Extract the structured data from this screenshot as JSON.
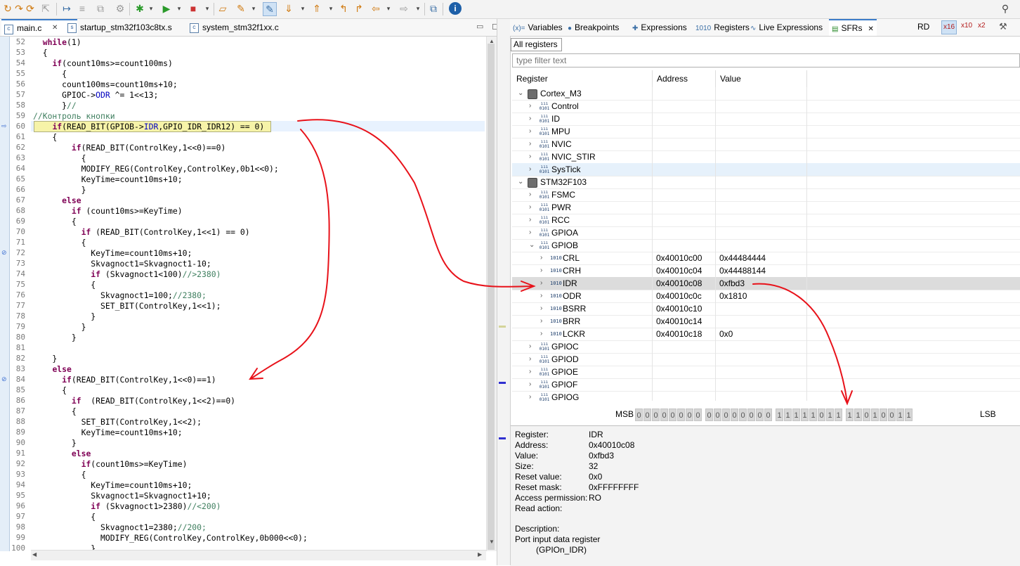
{
  "toolbar": {
    "icons": [
      "debug-icon",
      "restart-icon",
      "skip-icon",
      "terminate-icon",
      "step-into-icon",
      "step-over-icon",
      "step-return-icon",
      "run-icon",
      "debug-dropdown-icon",
      "run-dropdown-icon",
      "stop-icon",
      "open-folder-icon",
      "pin-icon",
      "highlight-icon",
      "next-annotation-icon",
      "prev-annotation-icon",
      "back-icon",
      "forward-icon",
      "open-perspective-icon",
      "info-icon",
      "search-icon"
    ]
  },
  "editor": {
    "tabs": [
      {
        "label": "main.c",
        "icon": "c",
        "close": "✕"
      },
      {
        "label": "startup_stm32f103c8tx.s",
        "icon": "s"
      },
      {
        "label": "system_stm32f1xx.c",
        "icon": "c"
      }
    ],
    "lines": [
      {
        "n": "52",
        "t": "  while(1)"
      },
      {
        "n": "53",
        "t": "  {"
      },
      {
        "n": "54",
        "t": "    if(count10ms>=count100ms)"
      },
      {
        "n": "55",
        "t": "      {"
      },
      {
        "n": "56",
        "t": "      count100ms=count10ms+10;"
      },
      {
        "n": "57",
        "t": "      GPIOC->ODR ^= 1<<13;"
      },
      {
        "n": "58",
        "t": "      }//"
      },
      {
        "n": "59",
        "t": "//Контроль кнопки"
      },
      {
        "n": "60",
        "t": "    if(READ_BIT(GPIOB->IDR,GPIO_IDR_IDR12) == 0)"
      },
      {
        "n": "61",
        "t": "    {"
      },
      {
        "n": "62",
        "t": "        if(READ_BIT(ControlKey,1<<0)==0)"
      },
      {
        "n": "63",
        "t": "          {"
      },
      {
        "n": "64",
        "t": "          MODIFY_REG(ControlKey,ControlKey,0b1<<0);"
      },
      {
        "n": "65",
        "t": "          KeyTime=count10ms+10;"
      },
      {
        "n": "66",
        "t": "          }"
      },
      {
        "n": "67",
        "t": "      else"
      },
      {
        "n": "68",
        "t": "        if (count10ms>=KeyTime)"
      },
      {
        "n": "69",
        "t": "        {"
      },
      {
        "n": "70",
        "t": "          if (READ_BIT(ControlKey,1<<1) == 0)"
      },
      {
        "n": "71",
        "t": "          {"
      },
      {
        "n": "72",
        "t": "            KeyTime=count10ms+10;"
      },
      {
        "n": "73",
        "t": "            Skvagnoct1=Skvagnoct1-10;"
      },
      {
        "n": "74",
        "t": "            if (Skvagnoct1<100)//>2380)"
      },
      {
        "n": "75",
        "t": "            {"
      },
      {
        "n": "76",
        "t": "              Skvagnoct1=100;//2380;"
      },
      {
        "n": "77",
        "t": "              SET_BIT(ControlKey,1<<1);"
      },
      {
        "n": "78",
        "t": "            }"
      },
      {
        "n": "79",
        "t": "          }"
      },
      {
        "n": "80",
        "t": "        }"
      },
      {
        "n": "81",
        "t": ""
      },
      {
        "n": "82",
        "t": "    }"
      },
      {
        "n": "83",
        "t": "    else"
      },
      {
        "n": "84",
        "t": "      if(READ_BIT(ControlKey,1<<0)==1)"
      },
      {
        "n": "85",
        "t": "      {"
      },
      {
        "n": "86",
        "t": "        if  (READ_BIT(ControlKey,1<<2)==0)"
      },
      {
        "n": "87",
        "t": "        {"
      },
      {
        "n": "88",
        "t": "          SET_BIT(ControlKey,1<<2);"
      },
      {
        "n": "89",
        "t": "          KeyTime=count10ms+10;"
      },
      {
        "n": "90",
        "t": "        }"
      },
      {
        "n": "91",
        "t": "        else"
      },
      {
        "n": "92",
        "t": "          if(count10ms>=KeyTime)"
      },
      {
        "n": "93",
        "t": "          {"
      },
      {
        "n": "94",
        "t": "            KeyTime=count10ms+10;"
      },
      {
        "n": "95",
        "t": "            Skvagnoct1=Skvagnoct1+10;"
      },
      {
        "n": "96",
        "t": "            if (Skvagnoct1>2380)//<200)"
      },
      {
        "n": "97",
        "t": "            {"
      },
      {
        "n": "98",
        "t": "              Skvagnoct1=2380;//200;"
      },
      {
        "n": "99",
        "t": "              MODIFY_REG(ControlKey,ControlKey,0b000<<0);"
      },
      {
        "n": "100",
        "t": "            }"
      }
    ]
  },
  "views": {
    "tabs": [
      {
        "icon": "(x)=",
        "label": "Variables"
      },
      {
        "icon": "●",
        "label": "Breakpoints"
      },
      {
        "icon": "✚",
        "label": "Expressions"
      },
      {
        "icon": "1010",
        "label": "Registers"
      },
      {
        "icon": "∿",
        "label": "Live Expressions"
      },
      {
        "icon": "▤",
        "label": "SFRs",
        "close": "✕"
      }
    ],
    "right_buttons": [
      "RD",
      "x16",
      "x10",
      "x2"
    ],
    "sub_tab": "All registers",
    "filter_placeholder": "type filter text",
    "columns": [
      "Register",
      "Address",
      "Value"
    ],
    "rows": [
      {
        "level": 0,
        "chev": "v",
        "kind": "chip",
        "name": "Cortex_M3",
        "address": "",
        "value": ""
      },
      {
        "level": 1,
        "chev": ">",
        "kind": "reg",
        "name": "Control",
        "address": "",
        "value": ""
      },
      {
        "level": 1,
        "chev": ">",
        "kind": "reg",
        "name": "ID",
        "address": "",
        "value": ""
      },
      {
        "level": 1,
        "chev": ">",
        "kind": "reg",
        "name": "MPU",
        "address": "",
        "value": ""
      },
      {
        "level": 1,
        "chev": ">",
        "kind": "reg",
        "name": "NVIC",
        "address": "",
        "value": ""
      },
      {
        "level": 1,
        "chev": ">",
        "kind": "reg",
        "name": "NVIC_STIR",
        "address": "",
        "value": ""
      },
      {
        "level": 1,
        "chev": ">",
        "kind": "reg",
        "name": "SysTick",
        "address": "",
        "value": "",
        "hover": true
      },
      {
        "level": 0,
        "chev": "v",
        "kind": "chip",
        "name": "STM32F103",
        "address": "",
        "value": ""
      },
      {
        "level": 1,
        "chev": ">",
        "kind": "reg",
        "name": "FSMC",
        "address": "",
        "value": ""
      },
      {
        "level": 1,
        "chev": ">",
        "kind": "reg",
        "name": "PWR",
        "address": "",
        "value": ""
      },
      {
        "level": 1,
        "chev": ">",
        "kind": "reg",
        "name": "RCC",
        "address": "",
        "value": ""
      },
      {
        "level": 1,
        "chev": ">",
        "kind": "reg",
        "name": "GPIOA",
        "address": "",
        "value": ""
      },
      {
        "level": 1,
        "chev": "v",
        "kind": "reg",
        "name": "GPIOB",
        "address": "",
        "value": ""
      },
      {
        "level": 2,
        "chev": ">",
        "kind": "bits",
        "name": "CRL",
        "address": "0x40010c00",
        "value": "0x44484444"
      },
      {
        "level": 2,
        "chev": ">",
        "kind": "bits",
        "name": "CRH",
        "address": "0x40010c04",
        "value": "0x44488144"
      },
      {
        "level": 2,
        "chev": ">",
        "kind": "bits",
        "name": "IDR",
        "address": "0x40010c08",
        "value": "0xfbd3",
        "selected": true
      },
      {
        "level": 2,
        "chev": ">",
        "kind": "bits",
        "name": "ODR",
        "address": "0x40010c0c",
        "value": "0x1810"
      },
      {
        "level": 2,
        "chev": ">",
        "kind": "bits",
        "name": "BSRR",
        "address": "0x40010c10",
        "value": ""
      },
      {
        "level": 2,
        "chev": ">",
        "kind": "bits",
        "name": "BRR",
        "address": "0x40010c14",
        "value": ""
      },
      {
        "level": 2,
        "chev": ">",
        "kind": "bits",
        "name": "LCKR",
        "address": "0x40010c18",
        "value": "0x0"
      },
      {
        "level": 1,
        "chev": ">",
        "kind": "reg",
        "name": "GPIOC",
        "address": "",
        "value": ""
      },
      {
        "level": 1,
        "chev": ">",
        "kind": "reg",
        "name": "GPIOD",
        "address": "",
        "value": ""
      },
      {
        "level": 1,
        "chev": ">",
        "kind": "reg",
        "name": "GPIOE",
        "address": "",
        "value": ""
      },
      {
        "level": 1,
        "chev": ">",
        "kind": "reg",
        "name": "GPIOF",
        "address": "",
        "value": ""
      },
      {
        "level": 1,
        "chev": ">",
        "kind": "reg",
        "name": "GPIOG",
        "address": "",
        "value": ""
      }
    ],
    "bits": {
      "msb_label": "MSB",
      "lsb_label": "LSB",
      "values": [
        "0",
        "0",
        "0",
        "0",
        "0",
        "0",
        "0",
        "0",
        "0",
        "0",
        "0",
        "0",
        "0",
        "0",
        "0",
        "0",
        "1",
        "1",
        "1",
        "1",
        "1",
        "0",
        "1",
        "1",
        "1",
        "1",
        "0",
        "1",
        "0",
        "0",
        "1",
        "1"
      ]
    },
    "details": {
      "fields": [
        {
          "label": "Register:",
          "value": "IDR"
        },
        {
          "label": "Address:",
          "value": "0x40010c08"
        },
        {
          "label": "Value:",
          "value": "0xfbd3"
        },
        {
          "label": "Size:",
          "value": "32"
        },
        {
          "label": "Reset value:",
          "value": "0x0"
        },
        {
          "label": "Reset mask:",
          "value": "0xFFFFFFFF"
        },
        {
          "label": "Access permission:",
          "value": "RO"
        },
        {
          "label": "Read action:",
          "value": ""
        }
      ],
      "description_label": "Description:",
      "description": "Port input data register",
      "description2": "(GPIOn_IDR)"
    }
  },
  "colors": {
    "annotation_arrow": "#e8121a",
    "keyword": "#7f0055",
    "comment": "#3f7f5f",
    "field": "#0000c0"
  }
}
